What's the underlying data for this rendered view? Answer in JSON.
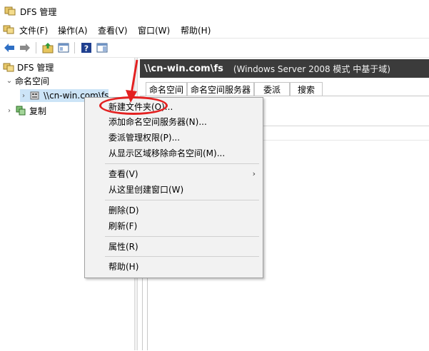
{
  "window": {
    "title": "DFS 管理"
  },
  "menubar": {
    "items": [
      {
        "label": "文件(F)"
      },
      {
        "label": "操作(A)"
      },
      {
        "label": "查看(V)"
      },
      {
        "label": "窗口(W)"
      },
      {
        "label": "帮助(H)"
      }
    ]
  },
  "toolbar": {
    "icons": [
      "back-arrow-icon",
      "forward-arrow-icon",
      "up-folder-icon",
      "show-hide-tree-icon",
      "help-icon",
      "action-pane-icon"
    ]
  },
  "tree": {
    "root": "DFS 管理",
    "namespaces": "命名空间",
    "namespace_item": "\\\\cn-win.com\\fs",
    "replication": "复制"
  },
  "right_pane": {
    "path": "\\\\cn-win.com\\fs",
    "subtitle": "(Windows Server 2008 模式 中基于域)",
    "tabs": [
      {
        "label": "命名空间"
      },
      {
        "label": "命名空间服务器"
      },
      {
        "label": "委派"
      },
      {
        "label": "搜索"
      }
    ]
  },
  "context_menu": {
    "new_folder": "新建文件夹(O)...",
    "add_server": "添加命名空间服务器(N)...",
    "delegate": "委派管理权限(P)...",
    "remove_display": "从显示区域移除命名空间(M)...",
    "view": "查看(V)",
    "new_window": "从这里创建窗口(W)",
    "delete": "删除(D)",
    "refresh": "刷新(F)",
    "properties": "属性(R)",
    "help": "帮助(H)"
  },
  "colors": {
    "header_bg": "#3b3b3b",
    "annotation_red": "#e32121",
    "menu_bg": "#f2f2f2"
  }
}
